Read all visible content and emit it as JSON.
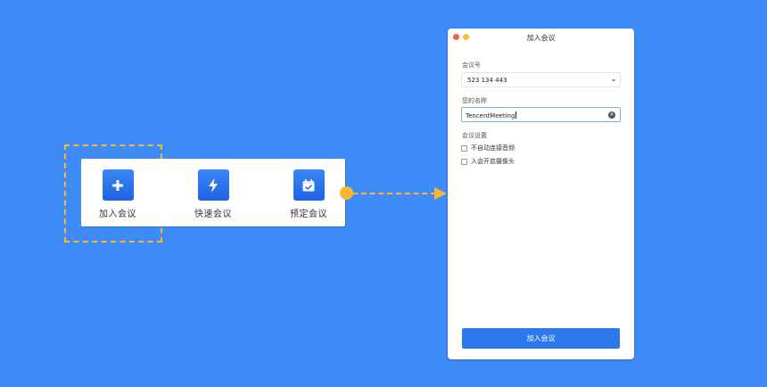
{
  "actions": [
    {
      "label": "加入会议",
      "icon": "plus-icon"
    },
    {
      "label": "快速会议",
      "icon": "lightning-icon"
    },
    {
      "label": "预定会议",
      "icon": "calendar-check-icon"
    }
  ],
  "dialog": {
    "title": "加入会议",
    "meeting_id_label": "会议号",
    "meeting_id_value": "523 134 443",
    "name_label": "您的名称",
    "name_value": "TencentMeeting",
    "settings_label": "会议设置",
    "options": [
      {
        "label": "不自动连接音频",
        "checked": false
      },
      {
        "label": "入会开启摄像头",
        "checked": false
      }
    ],
    "submit_label": "加入会议"
  },
  "colors": {
    "background": "#3f8cf8",
    "accent": "#2e78ee",
    "highlight": "#f7b731"
  }
}
